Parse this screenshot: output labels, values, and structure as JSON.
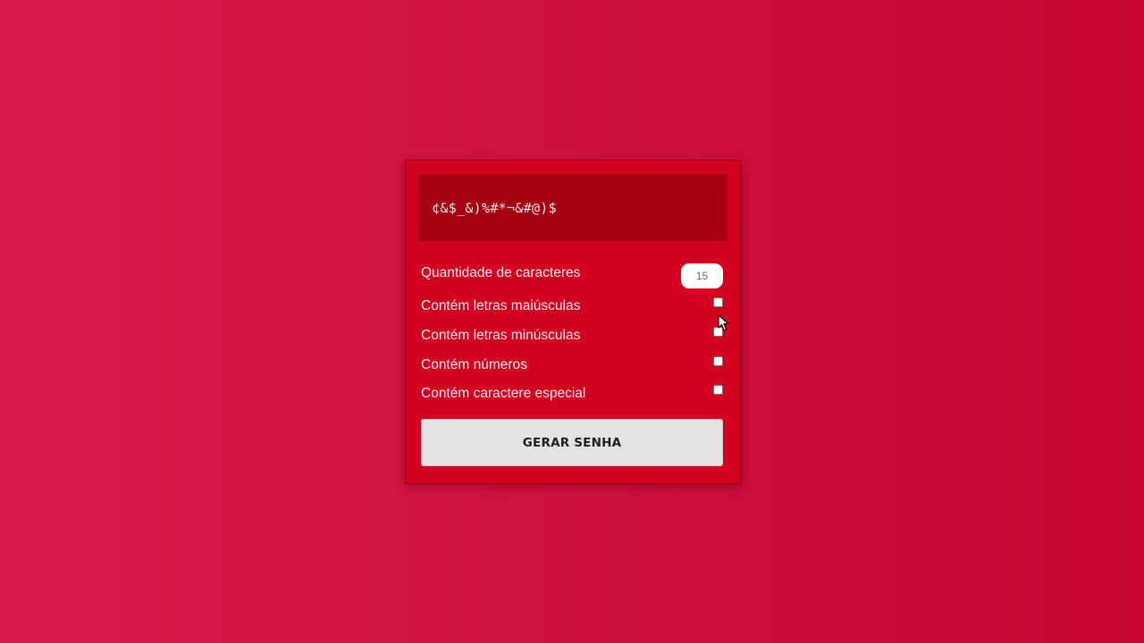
{
  "generator": {
    "password": "¢&$_&)%#*¬&#@)$",
    "length_label": "Quantidade de caracteres",
    "length_value": "15",
    "options": [
      {
        "label": "Contém letras maiúsculas",
        "checked": false
      },
      {
        "label": "Contém letras minúsculas",
        "checked": false
      },
      {
        "label": "Contém números",
        "checked": false
      },
      {
        "label": "Contém caractere especial",
        "checked": false
      }
    ],
    "generate_label": "GERAR SENHA"
  },
  "colors": {
    "background": "#d0123f",
    "card": "#d40020",
    "result_box": "#a50012",
    "button": "#e3e3e3"
  },
  "icons": {
    "cursor": "arrow-cursor-icon"
  }
}
